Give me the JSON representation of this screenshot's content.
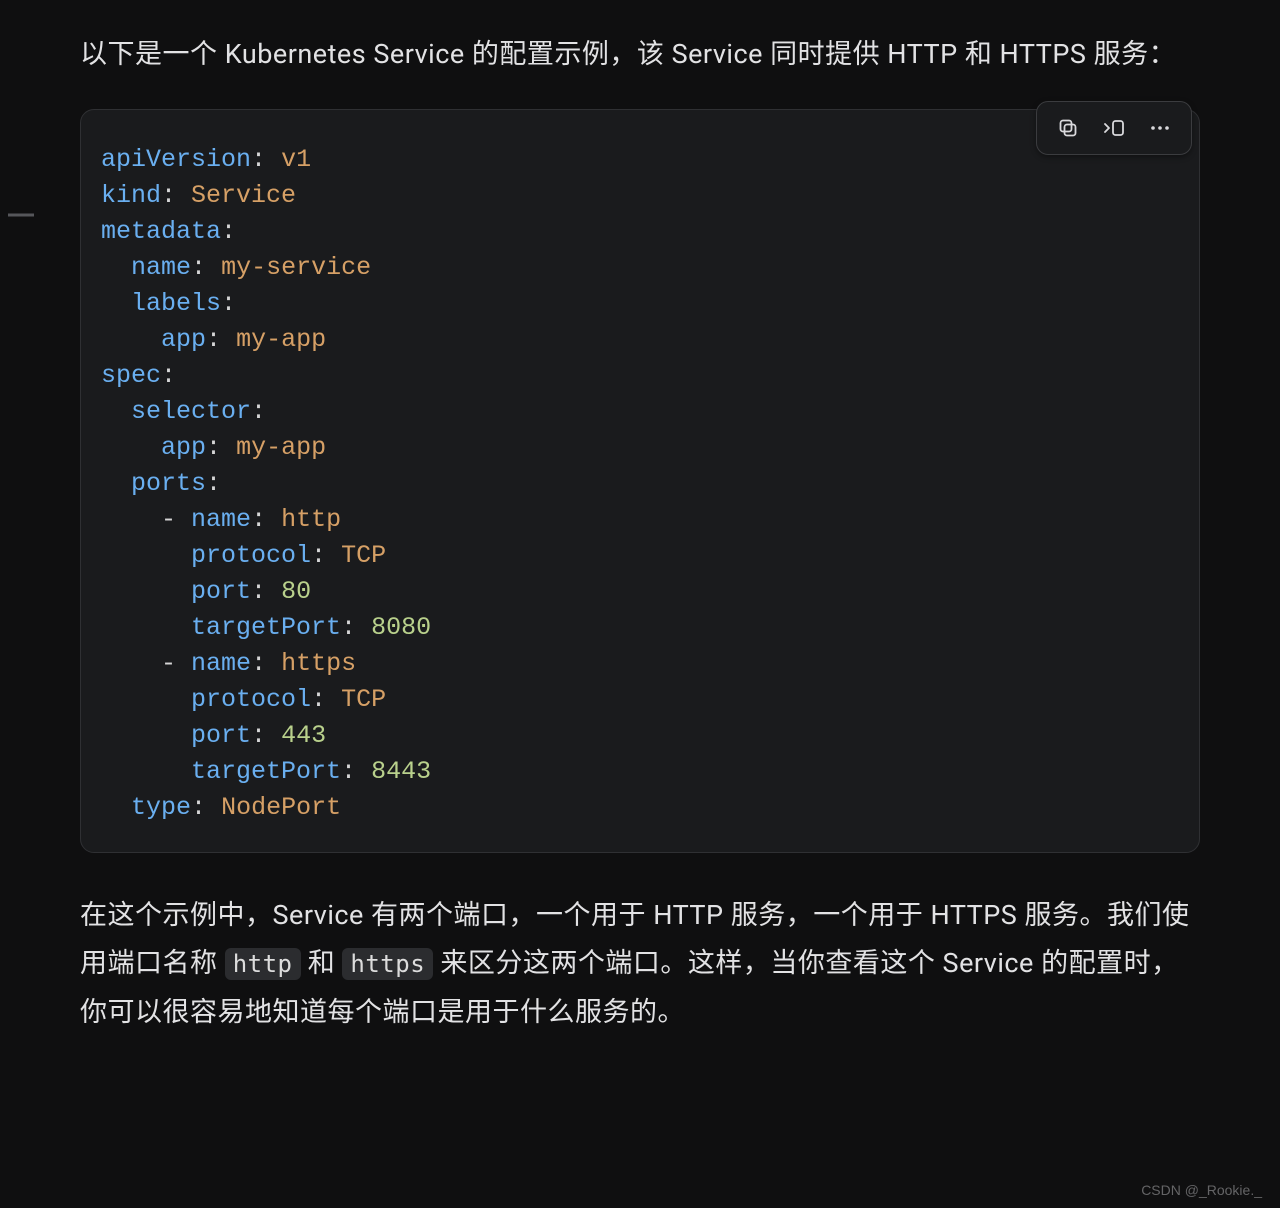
{
  "intro": "以下是一个 Kubernetes Service 的配置示例，该 Service 同时提供 HTTP 和 HTTPS 服务：",
  "outro_parts": {
    "p1": "在这个示例中，Service 有两个端口，一个用于 HTTP 服务，一个用于 HTTPS 服务。我们使用端口名称 ",
    "code1": "http",
    "p2": " 和 ",
    "code2": "https",
    "p3": " 来区分这两个端口。这样，当你查看这个 Service 的配置时，你可以很容易地知道每个端口是用于什么服务的。"
  },
  "yaml": {
    "apiVersion_key": "apiVersion",
    "apiVersion_val": "v1",
    "kind_key": "kind",
    "kind_val": "Service",
    "metadata_key": "metadata",
    "name_key": "name",
    "name_val": "my-service",
    "labels_key": "labels",
    "app_key": "app",
    "app_val": "my-app",
    "spec_key": "spec",
    "selector_key": "selector",
    "selector_app_key": "app",
    "selector_app_val": "my-app",
    "ports_key": "ports",
    "p0_name_key": "name",
    "p0_name_val": "http",
    "p0_protocol_key": "protocol",
    "p0_protocol_val": "TCP",
    "p0_port_key": "port",
    "p0_port_val": "80",
    "p0_targetPort_key": "targetPort",
    "p0_targetPort_val": "8080",
    "p1_name_key": "name",
    "p1_name_val": "https",
    "p1_protocol_key": "protocol",
    "p1_protocol_val": "TCP",
    "p1_port_key": "port",
    "p1_port_val": "443",
    "p1_targetPort_key": "targetPort",
    "p1_targetPort_val": "8443",
    "type_key": "type",
    "type_val": "NodePort"
  },
  "watermark": "CSDN @_Rookie._"
}
